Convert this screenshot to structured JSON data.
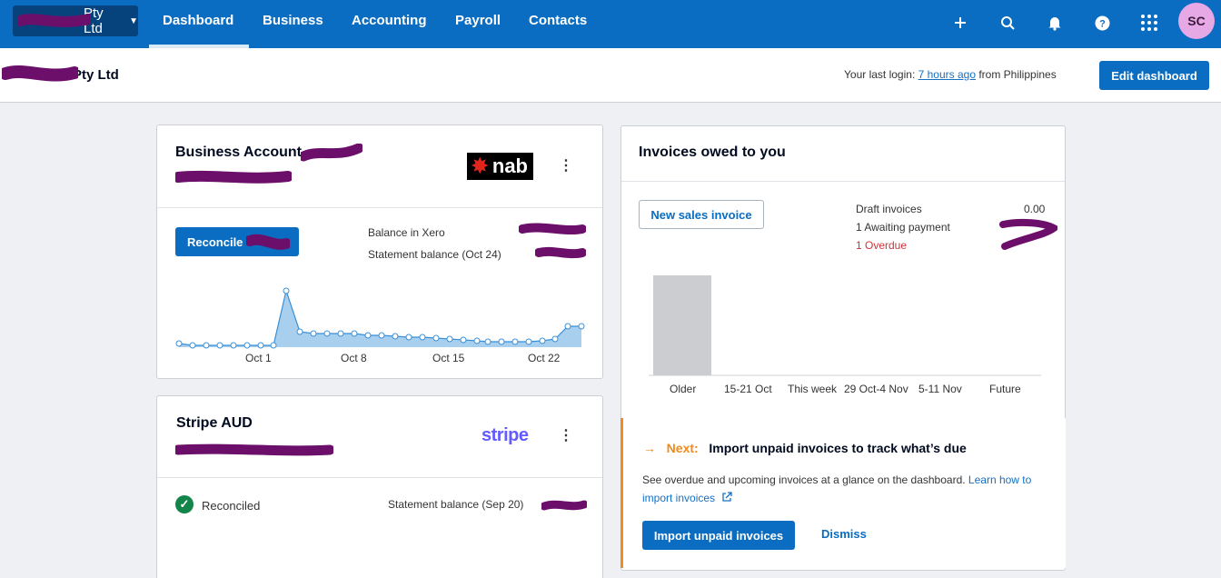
{
  "topnav": {
    "org_name": "Pty Ltd",
    "links": [
      "Dashboard",
      "Business",
      "Accounting",
      "Payroll",
      "Contacts"
    ],
    "avatar_initials": "SC",
    "icons": [
      "plus-icon",
      "search-icon",
      "bell-icon",
      "help-icon",
      "apps-grid-icon"
    ]
  },
  "subheader": {
    "org_name": "Pty Ltd",
    "last_login_prefix": "Your last login: ",
    "last_login_link": "7 hours ago",
    "last_login_suffix": " from Philippines",
    "edit_button": "Edit dashboard"
  },
  "bank_card": {
    "title": "Business Account",
    "bank_logo_text": "nab",
    "reconcile_button": "Reconcile",
    "balance_in_xero_label": "Balance in Xero",
    "statement_balance_label": "Statement balance (Oct 24)",
    "chart_labels": [
      "Oct 1",
      "Oct 8",
      "Oct 15",
      "Oct 22"
    ]
  },
  "stripe_card": {
    "title": "Stripe AUD",
    "logo_text": "stripe",
    "reconciled_label": "Reconciled",
    "statement_balance_label": "Statement balance (Sep 20)"
  },
  "invoices_card": {
    "title": "Invoices owed to you",
    "new_invoice_button": "New sales invoice",
    "draft_label": "Draft invoices",
    "draft_value": "0.00",
    "awaiting_label": "1 Awaiting payment",
    "overdue_label": "1 Overdue",
    "chart_data": {
      "type": "bar",
      "categories": [
        "Older",
        "15-21 Oct",
        "This week",
        "29 Oct-4 Nov",
        "5-11 Nov",
        "Future"
      ],
      "values": [
        1,
        0,
        0,
        0,
        0,
        0
      ]
    }
  },
  "next_panel": {
    "arrow": "→",
    "next_label": "Next:",
    "title": "Import unpaid invoices to track what’s due",
    "description": "See overdue and upcoming invoices at a glance on the dashboard. ",
    "learn_link": "Learn how to import invoices",
    "import_button": "Import unpaid invoices",
    "dismiss": "Dismiss"
  },
  "colors": {
    "brand_blue": "#0a6dc2",
    "overdue_red": "#d1323a",
    "next_orange": "#f28a1d",
    "redaction_purple": "#6b0f6b"
  }
}
